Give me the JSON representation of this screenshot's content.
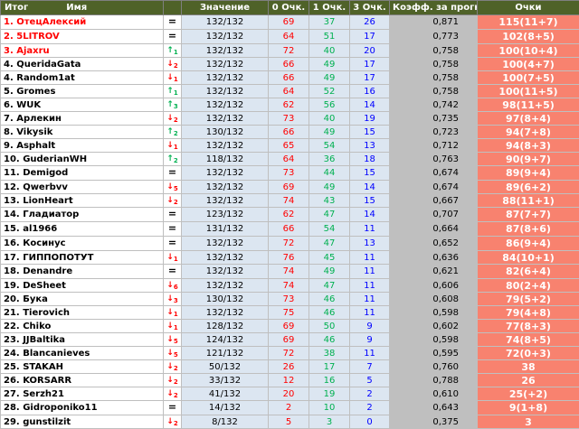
{
  "header": {
    "itog": "Итог",
    "name": "Имя",
    "value": "Значение",
    "zero": "0 Очк.",
    "one": "1 Очк.",
    "three": "3 Очк.",
    "koef": "Коэфф. за прогноз",
    "points": "Очки"
  },
  "colors": {
    "header_bg": "#4f6228",
    "value_bg": "#dce6f1",
    "koef_bg": "#bfbfbf",
    "points_bg": "#f8826f",
    "up": "#00b050",
    "down": "#ff0000",
    "zero_text": "#ff0000",
    "one_text": "#00b050",
    "three_text": "#0000ff"
  },
  "rows": [
    {
      "name": "1. ОтецАлексий",
      "top": true,
      "dir": "same",
      "arrow": "=",
      "delta": "",
      "value": "132/132",
      "zero": "69",
      "one": "37",
      "three": "26",
      "koef": "0,871",
      "points": "115(11+7)"
    },
    {
      "name": "2. 5LITROV",
      "top": true,
      "dir": "same",
      "arrow": "=",
      "delta": "",
      "value": "132/132",
      "zero": "64",
      "one": "51",
      "three": "17",
      "koef": "0,773",
      "points": "102(8+5)"
    },
    {
      "name": "3. Ajaxru",
      "top": true,
      "dir": "up",
      "arrow": "↑",
      "delta": "1",
      "value": "132/132",
      "zero": "72",
      "one": "40",
      "three": "20",
      "koef": "0,758",
      "points": "100(10+4)"
    },
    {
      "name": "4. QueridaGata",
      "top": false,
      "dir": "down",
      "arrow": "↓",
      "delta": "2",
      "value": "132/132",
      "zero": "66",
      "one": "49",
      "three": "17",
      "koef": "0,758",
      "points": "100(4+7)"
    },
    {
      "name": "4. Random1at",
      "top": false,
      "dir": "down",
      "arrow": "↓",
      "delta": "1",
      "value": "132/132",
      "zero": "66",
      "one": "49",
      "three": "17",
      "koef": "0,758",
      "points": "100(7+5)"
    },
    {
      "name": "5. Gromes",
      "top": false,
      "dir": "up",
      "arrow": "↑",
      "delta": "1",
      "value": "132/132",
      "zero": "64",
      "one": "52",
      "three": "16",
      "koef": "0,758",
      "points": "100(11+5)"
    },
    {
      "name": "6. WUK",
      "top": false,
      "dir": "up",
      "arrow": "↑",
      "delta": "3",
      "value": "132/132",
      "zero": "62",
      "one": "56",
      "three": "14",
      "koef": "0,742",
      "points": "98(11+5)"
    },
    {
      "name": "7. Арлекин",
      "top": false,
      "dir": "down",
      "arrow": "↓",
      "delta": "2",
      "value": "132/132",
      "zero": "73",
      "one": "40",
      "three": "19",
      "koef": "0,735",
      "points": "97(8+4)"
    },
    {
      "name": "8. Vikysik",
      "top": false,
      "dir": "up",
      "arrow": "↑",
      "delta": "2",
      "value": "130/132",
      "zero": "66",
      "one": "49",
      "three": "15",
      "koef": "0,723",
      "points": "94(7+8)"
    },
    {
      "name": "9. Asphalt",
      "top": false,
      "dir": "down",
      "arrow": "↓",
      "delta": "1",
      "value": "132/132",
      "zero": "65",
      "one": "54",
      "three": "13",
      "koef": "0,712",
      "points": "94(8+3)"
    },
    {
      "name": "10. GuderianWH",
      "top": false,
      "dir": "up",
      "arrow": "↑",
      "delta": "2",
      "value": "118/132",
      "zero": "64",
      "one": "36",
      "three": "18",
      "koef": "0,763",
      "points": "90(9+7)"
    },
    {
      "name": "11. Demigod",
      "top": false,
      "dir": "same",
      "arrow": "=",
      "delta": "",
      "value": "132/132",
      "zero": "73",
      "one": "44",
      "three": "15",
      "koef": "0,674",
      "points": "89(9+4)"
    },
    {
      "name": "12. Qwerbvv",
      "top": false,
      "dir": "down",
      "arrow": "↓",
      "delta": "5",
      "value": "132/132",
      "zero": "69",
      "one": "49",
      "three": "14",
      "koef": "0,674",
      "points": "89(6+2)"
    },
    {
      "name": "13. LionHeart",
      "top": false,
      "dir": "down",
      "arrow": "↓",
      "delta": "2",
      "value": "132/132",
      "zero": "74",
      "one": "43",
      "three": "15",
      "koef": "0,667",
      "points": "88(11+1)"
    },
    {
      "name": "14. Гладиатор",
      "top": false,
      "dir": "same",
      "arrow": "=",
      "delta": "",
      "value": "123/132",
      "zero": "62",
      "one": "47",
      "three": "14",
      "koef": "0,707",
      "points": "87(7+7)"
    },
    {
      "name": "15. al1966",
      "top": false,
      "dir": "same",
      "arrow": "=",
      "delta": "",
      "value": "131/132",
      "zero": "66",
      "one": "54",
      "three": "11",
      "koef": "0,664",
      "points": "87(8+6)"
    },
    {
      "name": "16. Косинус",
      "top": false,
      "dir": "same",
      "arrow": "=",
      "delta": "",
      "value": "132/132",
      "zero": "72",
      "one": "47",
      "three": "13",
      "koef": "0,652",
      "points": "86(9+4)"
    },
    {
      "name": "17. ГИППОПОТУТ",
      "top": false,
      "dir": "down",
      "arrow": "↓",
      "delta": "1",
      "value": "132/132",
      "zero": "76",
      "one": "45",
      "three": "11",
      "koef": "0,636",
      "points": "84(10+1)"
    },
    {
      "name": "18. Denandre",
      "top": false,
      "dir": "same",
      "arrow": "=",
      "delta": "",
      "value": "132/132",
      "zero": "74",
      "one": "49",
      "three": "11",
      "koef": "0,621",
      "points": "82(6+4)"
    },
    {
      "name": "19. DeSheet",
      "top": false,
      "dir": "down",
      "arrow": "↓",
      "delta": "6",
      "value": "132/132",
      "zero": "74",
      "one": "47",
      "three": "11",
      "koef": "0,606",
      "points": "80(2+4)"
    },
    {
      "name": "20. Бука",
      "top": false,
      "dir": "down",
      "arrow": "↓",
      "delta": "3",
      "value": "130/132",
      "zero": "73",
      "one": "46",
      "three": "11",
      "koef": "0,608",
      "points": "79(5+2)"
    },
    {
      "name": "21. Tierovich",
      "top": false,
      "dir": "down",
      "arrow": "↓",
      "delta": "1",
      "value": "132/132",
      "zero": "75",
      "one": "46",
      "three": "11",
      "koef": "0,598",
      "points": "79(4+8)"
    },
    {
      "name": "22. Chiko",
      "top": false,
      "dir": "down",
      "arrow": "↓",
      "delta": "1",
      "value": "128/132",
      "zero": "69",
      "one": "50",
      "three": "9",
      "koef": "0,602",
      "points": "77(8+3)"
    },
    {
      "name": "23. JJBaltika",
      "top": false,
      "dir": "down",
      "arrow": "↓",
      "delta": "5",
      "value": "124/132",
      "zero": "69",
      "one": "46",
      "three": "9",
      "koef": "0,598",
      "points": "74(8+5)"
    },
    {
      "name": "24. Blancanieves",
      "top": false,
      "dir": "down",
      "arrow": "↓",
      "delta": "5",
      "value": "121/132",
      "zero": "72",
      "one": "38",
      "three": "11",
      "koef": "0,595",
      "points": "72(0+3)"
    },
    {
      "name": "25. STAKAH",
      "top": false,
      "dir": "down",
      "arrow": "↓",
      "delta": "2",
      "value": "50/132",
      "zero": "26",
      "one": "17",
      "three": "7",
      "koef": "0,760",
      "points": "38"
    },
    {
      "name": "26. KORSARR",
      "top": false,
      "dir": "down",
      "arrow": "↓",
      "delta": "2",
      "value": "33/132",
      "zero": "12",
      "one": "16",
      "three": "5",
      "koef": "0,788",
      "points": "26"
    },
    {
      "name": "27. Serzh21",
      "top": false,
      "dir": "down",
      "arrow": "↓",
      "delta": "2",
      "value": "41/132",
      "zero": "20",
      "one": "19",
      "three": "2",
      "koef": "0,610",
      "points": "25(+2)"
    },
    {
      "name": "28. Gidroponiko11",
      "top": false,
      "dir": "same",
      "arrow": "=",
      "delta": "",
      "value": "14/132",
      "zero": "2",
      "one": "10",
      "three": "2",
      "koef": "0,643",
      "points": "9(1+8)"
    },
    {
      "name": "29. gunstilzit",
      "top": false,
      "dir": "down",
      "arrow": "↓",
      "delta": "2",
      "value": "8/132",
      "zero": "5",
      "one": "3",
      "three": "0",
      "koef": "0,375",
      "points": "3"
    }
  ]
}
